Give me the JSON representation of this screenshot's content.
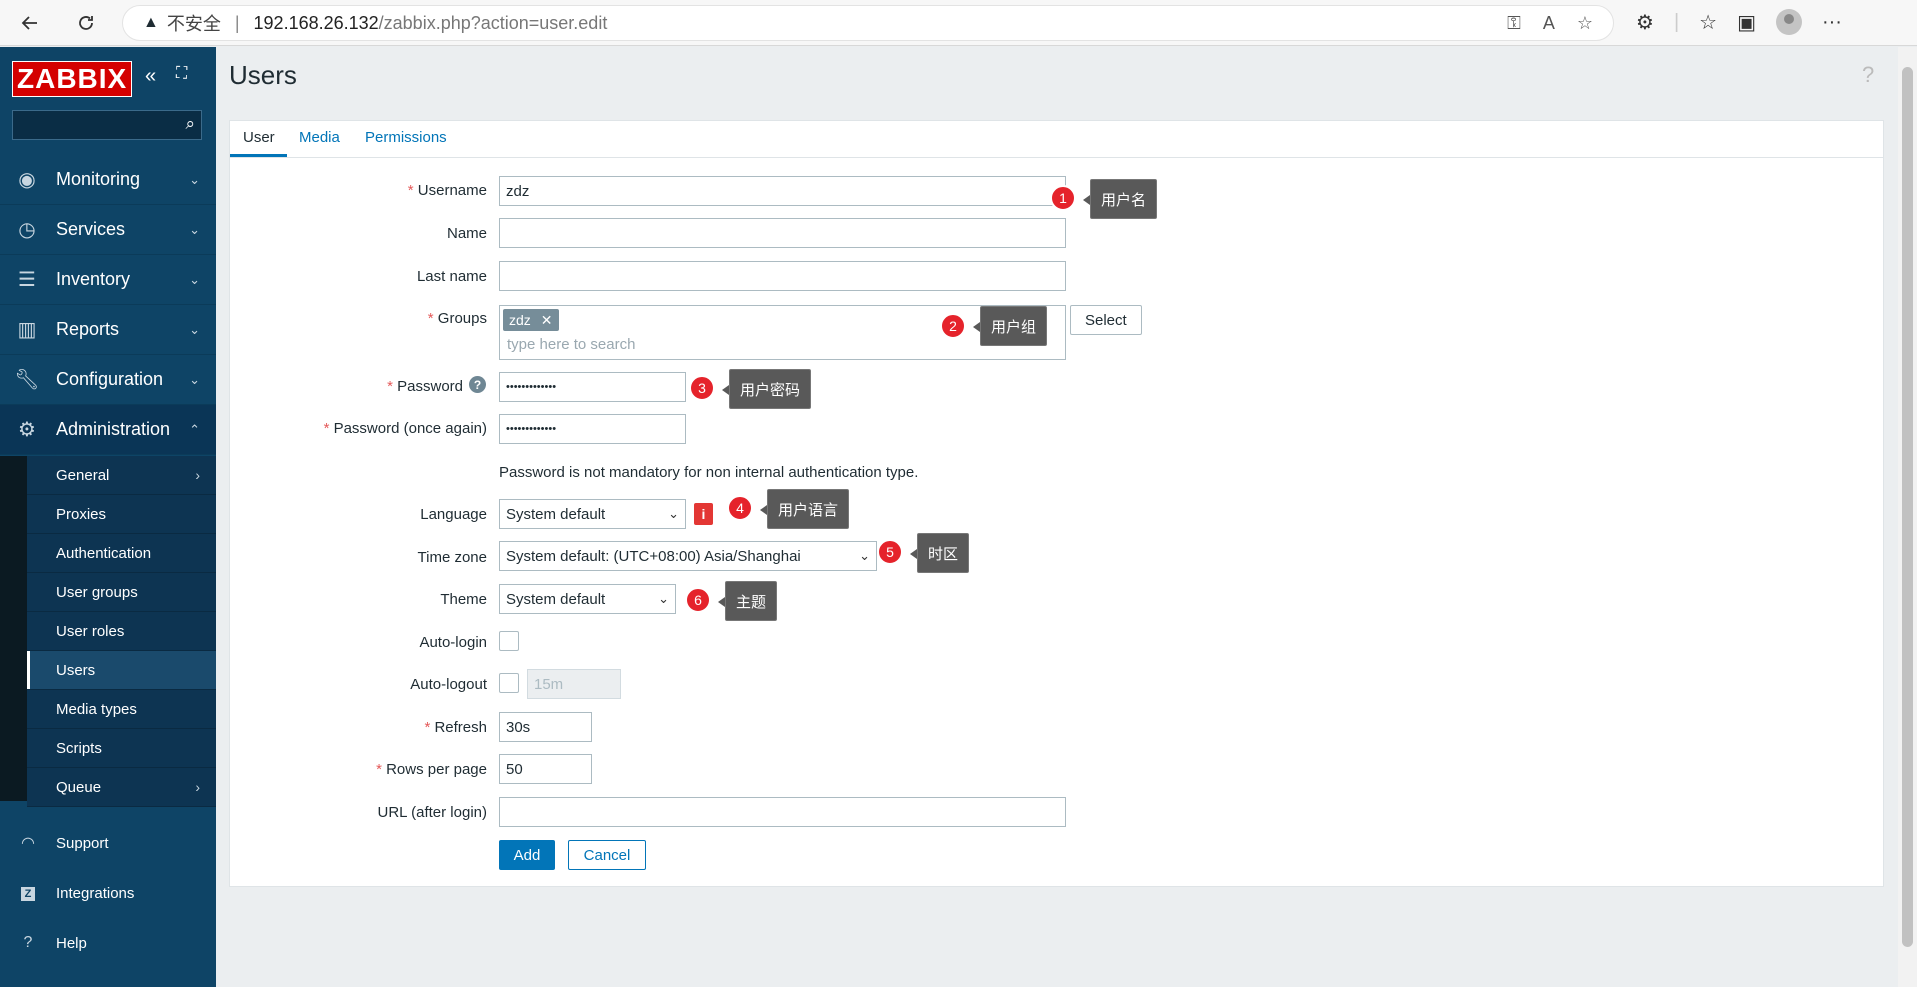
{
  "browser": {
    "insecure_label": "不安全",
    "url_host": "192.168.26.132",
    "url_path": "/zabbix.php?action=user.edit"
  },
  "sidebar": {
    "logo": "ZABBIX",
    "menu": [
      {
        "label": "Monitoring",
        "icon": "eye-icon"
      },
      {
        "label": "Services",
        "icon": "clock-icon"
      },
      {
        "label": "Inventory",
        "icon": "list-icon"
      },
      {
        "label": "Reports",
        "icon": "bar-chart-icon"
      },
      {
        "label": "Configuration",
        "icon": "wrench-icon"
      },
      {
        "label": "Administration",
        "icon": "gear-icon"
      }
    ],
    "submenu": [
      {
        "label": "General"
      },
      {
        "label": "Proxies"
      },
      {
        "label": "Authentication"
      },
      {
        "label": "User groups"
      },
      {
        "label": "User roles"
      },
      {
        "label": "Users"
      },
      {
        "label": "Media types"
      },
      {
        "label": "Scripts"
      },
      {
        "label": "Queue"
      }
    ],
    "bottom": [
      {
        "label": "Support",
        "icon": "headset-icon"
      },
      {
        "label": "Integrations",
        "icon": "z-icon"
      },
      {
        "label": "Help",
        "icon": "question-icon"
      }
    ]
  },
  "page": {
    "title": "Users",
    "help": "?"
  },
  "tabs": [
    "User",
    "Media",
    "Permissions"
  ],
  "form": {
    "username_label": "Username",
    "username_value": "zdz",
    "name_label": "Name",
    "lastname_label": "Last name",
    "groups_label": "Groups",
    "groups_chip": "zdz",
    "groups_placeholder": "type here to search",
    "select_button": "Select",
    "password_label": "Password",
    "password_value": "•••••••••••••",
    "password2_label": "Password (once again)",
    "password2_value": "•••••••••••••",
    "password_note": "Password is not mandatory for non internal authentication type.",
    "language_label": "Language",
    "language_value": "System default",
    "timezone_label": "Time zone",
    "timezone_value": "System default: (UTC+08:00) Asia/Shanghai",
    "theme_label": "Theme",
    "theme_value": "System default",
    "autologin_label": "Auto-login",
    "autologout_label": "Auto-logout",
    "autologout_value": "15m",
    "refresh_label": "Refresh",
    "refresh_value": "30s",
    "rows_label": "Rows per page",
    "rows_value": "50",
    "url_label": "URL (after login)",
    "add_button": "Add",
    "cancel_button": "Cancel"
  },
  "annotations": [
    {
      "num": "1",
      "text": "用户名"
    },
    {
      "num": "2",
      "text": "用户组"
    },
    {
      "num": "3",
      "text": "用户密码"
    },
    {
      "num": "4",
      "text": "用户语言"
    },
    {
      "num": "5",
      "text": "时区"
    },
    {
      "num": "6",
      "text": "主题"
    }
  ],
  "colors": {
    "sidebar": "#0e4466",
    "accent": "#0275b8",
    "required": "#e45959",
    "badge": "#e5232b",
    "logo": "#d40000"
  }
}
